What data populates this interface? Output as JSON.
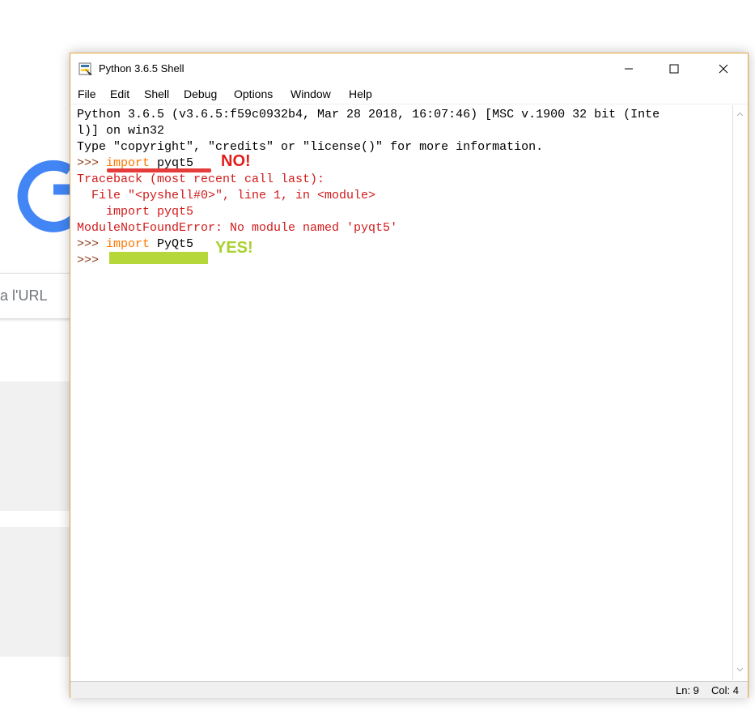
{
  "background": {
    "search_hint": "a l'URL"
  },
  "window": {
    "title": "Python 3.6.5 Shell",
    "controls": {
      "minimize": "minimize-icon",
      "maximize": "maximize-icon",
      "close": "close-icon"
    },
    "menu": [
      "File",
      "Edit",
      "Shell",
      "Debug",
      "Options",
      "Window",
      "Help"
    ],
    "console": {
      "lines": [
        "Python 3.6.5 (v3.6.5:f59c0932b4, Mar 28 2018, 16:07:46) [MSC v.1900 32 bit (Inte",
        "l)] on win32",
        "Type \"copyright\", \"credits\" or \"license()\" for more information.",
        ">>> ",
        "import",
        " pyqt5",
        "Traceback (most recent call last):",
        "  File \"<pyshell#0>\", line 1, in <module>",
        "    import pyqt5",
        "ModuleNotFoundError: No module named 'pyqt5'",
        ">>> ",
        "import",
        " PyQt5",
        ">>> "
      ]
    },
    "status": {
      "ln": "Ln: 9",
      "col": "Col: 4"
    }
  },
  "annotations": {
    "no_label": "NO!",
    "yes_label": "YES!"
  },
  "colors": {
    "accent_border": "#e6a23c",
    "error_red": "#d11a1a",
    "keyword_orange": "#ff7700",
    "annotation_red": "#e0201c",
    "annotation_green": "#a9d12f"
  }
}
